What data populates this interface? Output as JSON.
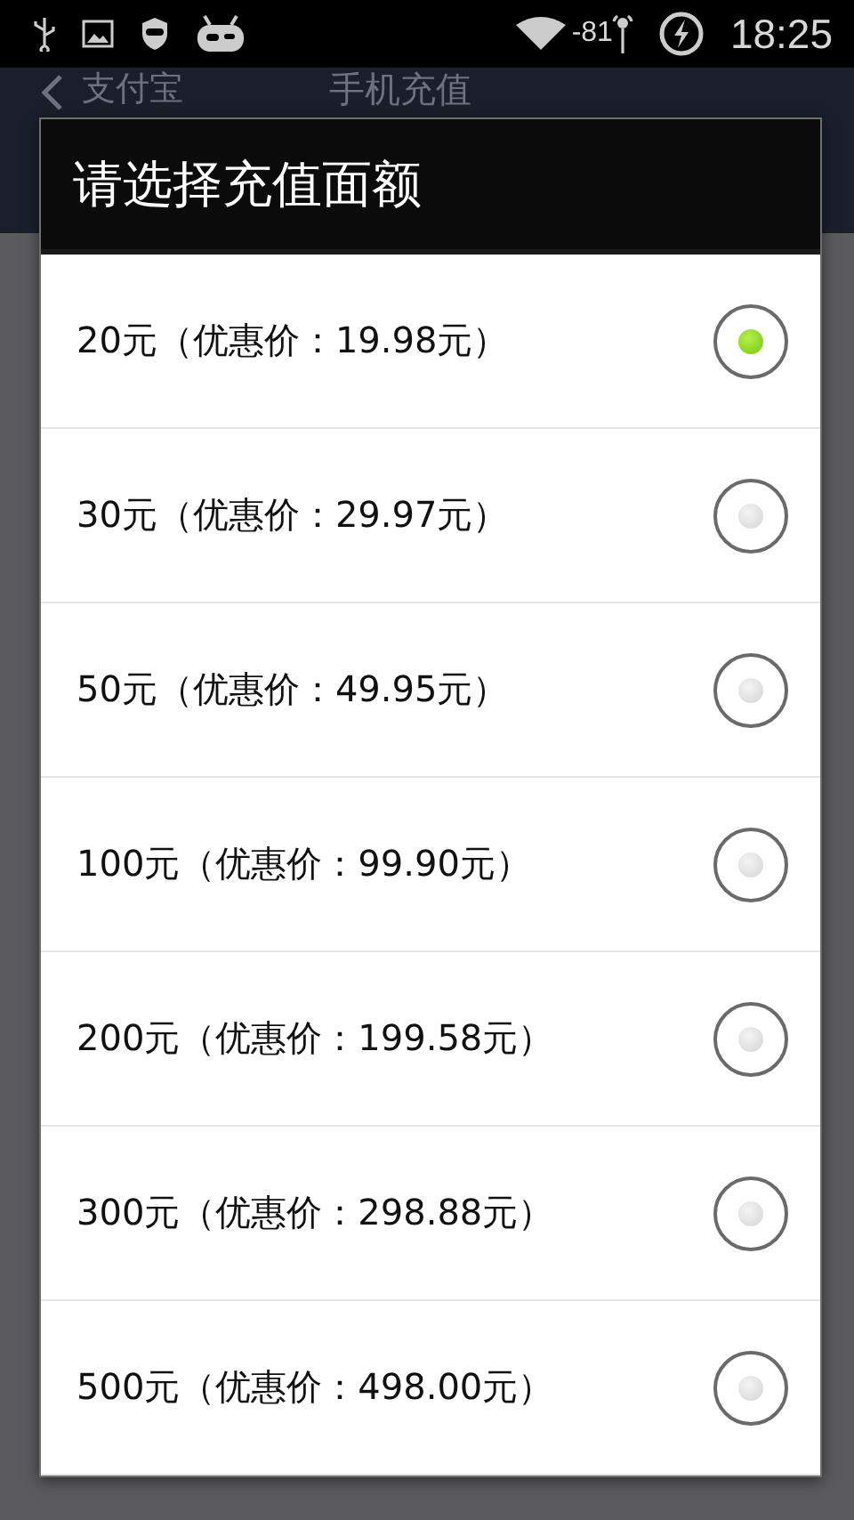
{
  "status_bar": {
    "signal_reading": "-81",
    "time": "18:25"
  },
  "app_bar": {
    "back_label": "支付宝",
    "title": "手机充值"
  },
  "dialog": {
    "title": "请选择充值面额",
    "options": [
      {
        "label": "20元（优惠价：19.98元）",
        "selected": true
      },
      {
        "label": "30元（优惠价：29.97元）",
        "selected": false
      },
      {
        "label": "50元（优惠价：49.95元）",
        "selected": false
      },
      {
        "label": "100元（优惠价：99.90元）",
        "selected": false
      },
      {
        "label": "200元（优惠价：199.58元）",
        "selected": false
      },
      {
        "label": "300元（优惠价：298.88元）",
        "selected": false
      },
      {
        "label": "500元（优惠价：498.00元）",
        "selected": false
      }
    ]
  }
}
